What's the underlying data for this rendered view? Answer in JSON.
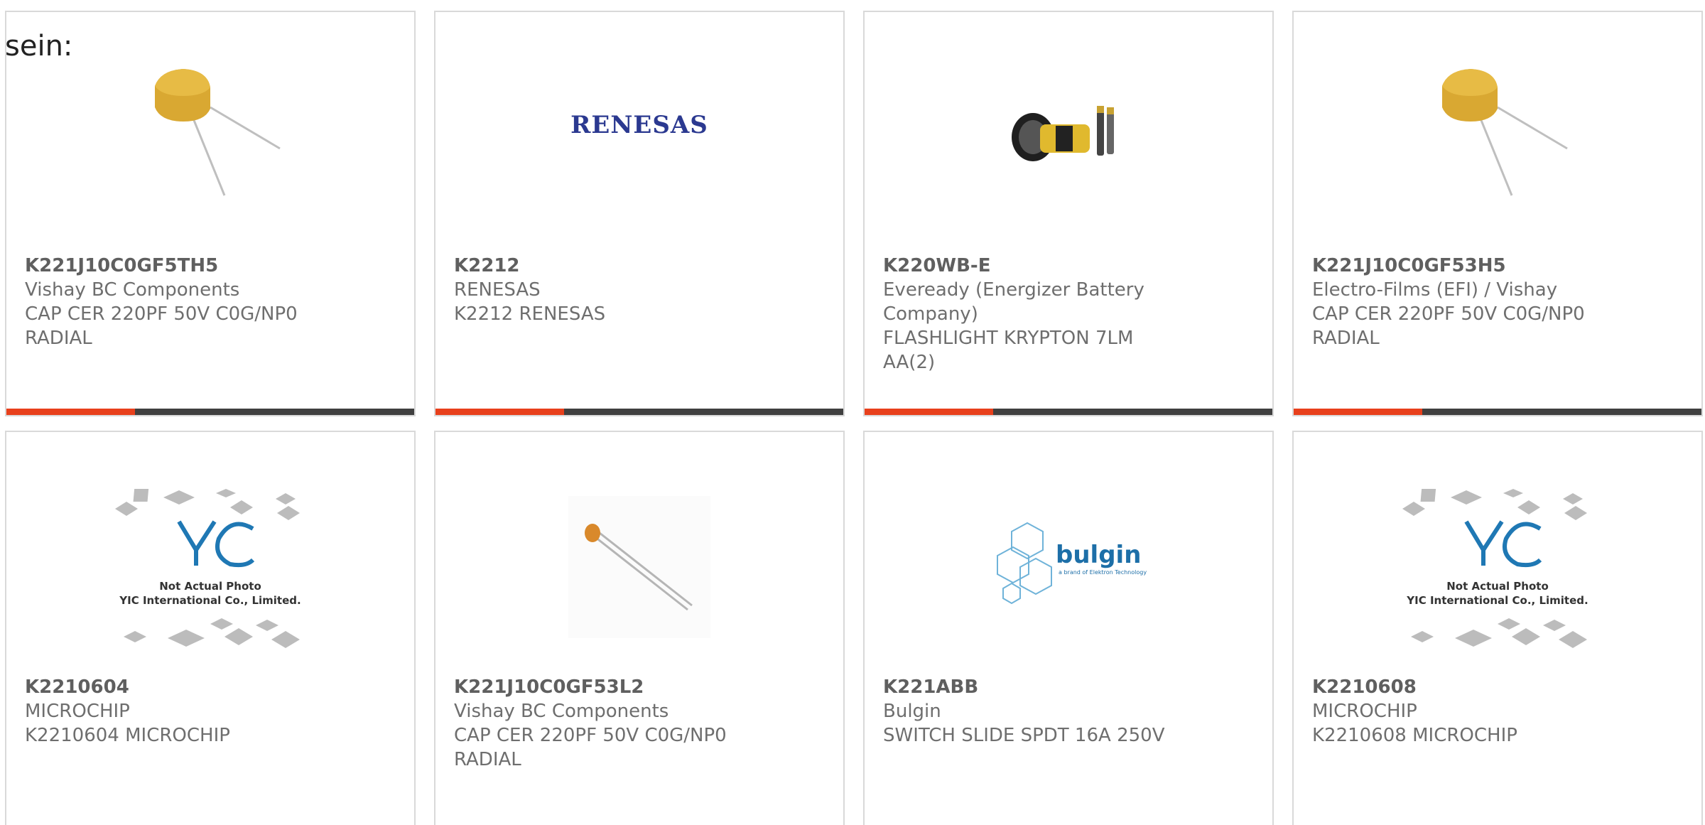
{
  "lead_text": "sein:",
  "colors": {
    "accent": "#e8401c",
    "bar": "#404040",
    "border": "#d9d9d9",
    "text": "#6e6e6e"
  },
  "cards": [
    {
      "part": "K221J10C0GF5TH5",
      "maker": "Vishay BC Components",
      "desc1": "CAP CER 220PF 50V C0G/NP0",
      "desc2": "RADIAL",
      "icon": "capacitor-radial-image"
    },
    {
      "part": "K2212",
      "maker": "RENESAS",
      "desc1": "K2212 RENESAS",
      "desc2": "",
      "icon": "renesas-logo-image",
      "logo_text": "RENESAS"
    },
    {
      "part": "K220WB-E",
      "maker": "Eveready (Energizer Battery",
      "maker2": "Company)",
      "desc1": "FLASHLIGHT KRYPTON 7LM",
      "desc2": "AA(2)",
      "icon": "flashlight-image"
    },
    {
      "part": "K221J10C0GF53H5",
      "maker": "Electro-Films (EFI) / Vishay",
      "desc1": "CAP CER 220PF 50V C0G/NP0",
      "desc2": "RADIAL",
      "icon": "capacitor-radial-image"
    },
    {
      "part": "K2210604",
      "maker": "MICROCHIP",
      "desc1": "K2210604 MICROCHIP",
      "desc2": "",
      "icon": "yic-placeholder-image",
      "ph1": "Not Actual Photo",
      "ph2": "YIC International Co., Limited."
    },
    {
      "part": "K221J10C0GF53L2",
      "maker": "Vishay BC Components",
      "desc1": "CAP CER 220PF 50V C0G/NP0",
      "desc2": "RADIAL",
      "icon": "ceramic-capacitor-image"
    },
    {
      "part": "K221ABB",
      "maker": "Bulgin",
      "desc1": "SWITCH SLIDE SPDT 16A 250V",
      "desc2": "",
      "icon": "bulgin-logo-image",
      "logo_text": "bulgin",
      "logo_sub": "a brand of Elektron Technology"
    },
    {
      "part": "K2210608",
      "maker": "MICROCHIP",
      "desc1": "K2210608 MICROCHIP",
      "desc2": "",
      "icon": "yic-placeholder-image",
      "ph1": "Not Actual Photo",
      "ph2": "YIC International Co., Limited."
    }
  ]
}
